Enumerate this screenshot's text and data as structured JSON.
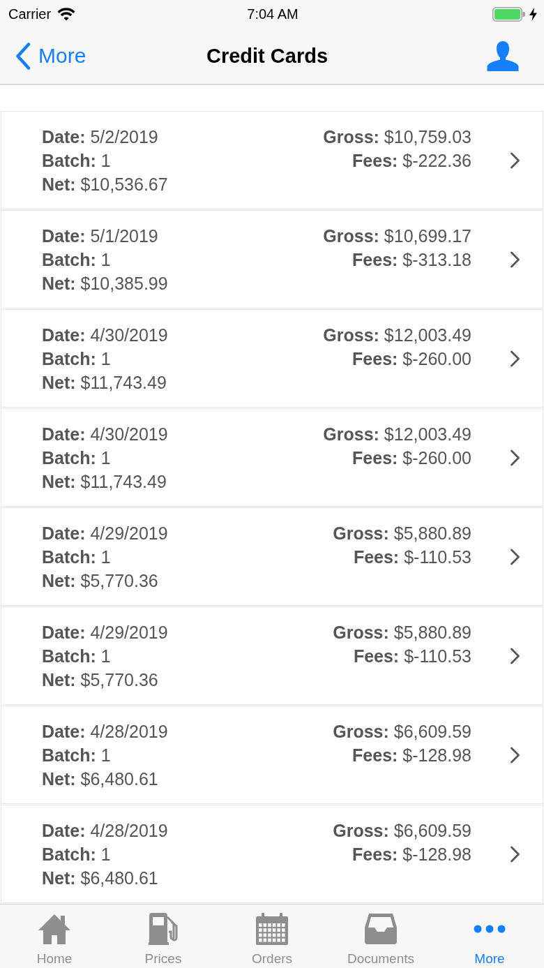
{
  "status_bar": {
    "carrier": "Carrier",
    "time": "7:04 AM"
  },
  "nav_bar": {
    "back": "More",
    "title": "Credit Cards"
  },
  "rows": [
    {
      "date": "**Date:** 5/2/2019",
      "batch": "**Batch:** 1",
      "net": "**Net:** $10,536.67",
      "gross": "**Gross:** $10,759.03",
      "fees": "**Fees:** $-222.36"
    },
    {
      "date": "**Date:** 5/1/2019",
      "batch": "**Batch:** 1",
      "net": "**Net:** $10,385.99",
      "gross": "**Gross:** $10,699.17",
      "fees": "**Fees:** $-313.18"
    },
    {
      "date": "**Date:** 4/30/2019",
      "batch": "**Batch:** 1",
      "net": "**Net:** $11,743.49",
      "gross": "**Gross:** $12,003.49",
      "fees": "**Fees:** $-260.00"
    },
    {
      "date": "**Date:** 4/30/2019",
      "batch": "**Batch:** 1",
      "net": "**Net:** $11,743.49",
      "gross": "**Gross:** $12,003.49",
      "fees": "**Fees:** $-260.00"
    },
    {
      "date": "**Date:** 4/29/2019",
      "batch": "**Batch:** 1",
      "net": "**Net:** $5,770.36",
      "gross": "**Gross:** $5,880.89",
      "fees": "**Fees:** $-110.53"
    },
    {
      "date": "**Date:** 4/29/2019",
      "batch": "**Batch:** 1",
      "net": "**Net:** $5,770.36",
      "gross": "**Gross:** $5,880.89",
      "fees": "**Fees:** $-110.53"
    },
    {
      "date": "**Date:** 4/28/2019",
      "batch": "**Batch:** 1",
      "net": "**Net:** $6,480.61",
      "gross": "**Gross:** $6,609.59",
      "fees": "**Fees:** $-128.98"
    },
    {
      "date": "**Date:** 4/28/2019",
      "batch": "**Batch:** 1",
      "net": "**Net:** $6,480.61",
      "gross": "**Gross:** $6,609.59",
      "fees": "**Fees:** $-128.98"
    }
  ],
  "tabs": [
    {
      "label": "Home",
      "selected": false
    },
    {
      "label": "Prices",
      "selected": false
    },
    {
      "label": "Orders",
      "selected": false
    },
    {
      "label": "Documents",
      "selected": false
    },
    {
      "label": "More",
      "selected": true
    }
  ]
}
